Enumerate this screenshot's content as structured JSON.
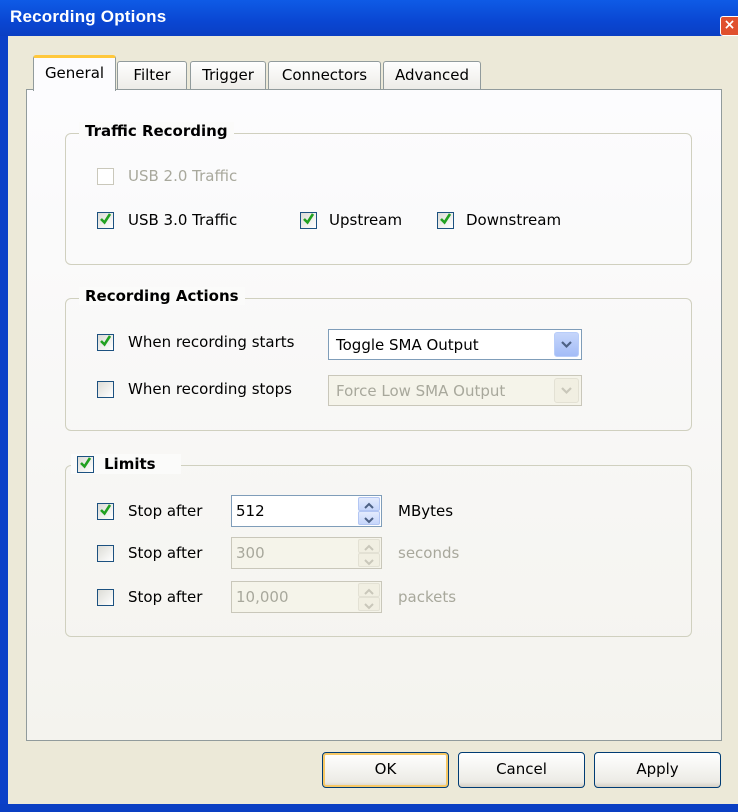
{
  "window": {
    "title": "Recording Options",
    "close_glyph": "×"
  },
  "tabs": [
    "General",
    "Filter",
    "Trigger",
    "Connectors",
    "Advanced"
  ],
  "active_tab": "General",
  "traffic_recording": {
    "title": "Traffic Recording",
    "usb2": {
      "label": "USB 2.0 Traffic",
      "checked": false,
      "enabled": false
    },
    "usb3": {
      "label": "USB 3.0 Traffic",
      "checked": true
    },
    "upstream": {
      "label": "Upstream",
      "checked": true
    },
    "downstream": {
      "label": "Downstream",
      "checked": true
    }
  },
  "recording_actions": {
    "title": "Recording Actions",
    "start": {
      "label": "When recording starts",
      "checked": true,
      "action": "Toggle SMA Output"
    },
    "stop": {
      "label": "When recording stops",
      "checked": false,
      "action": "Force Low SMA Output"
    }
  },
  "limits": {
    "title": "Limits",
    "checked": true,
    "rows": [
      {
        "label": "Stop after",
        "checked": true,
        "value": "512",
        "unit": "MBytes"
      },
      {
        "label": "Stop after",
        "checked": false,
        "value": "300",
        "unit": "seconds"
      },
      {
        "label": "Stop after",
        "checked": false,
        "value": "10,000",
        "unit": "packets"
      }
    ]
  },
  "buttons": {
    "ok": "OK",
    "cancel": "Cancel",
    "apply": "Apply"
  },
  "colors": {
    "titlebar": "#0a46d2",
    "dialog_bg": "#ece9d8",
    "check": "#21a121",
    "active_tab_accent": "#ffc83c"
  }
}
